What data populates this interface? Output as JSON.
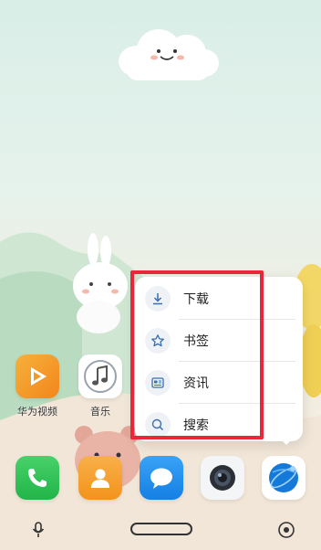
{
  "home": {
    "apps_row": [
      {
        "label": "华为视频",
        "icon": "huawei-video-icon"
      },
      {
        "label": "音乐",
        "icon": "music-icon"
      }
    ],
    "dock": [
      {
        "icon": "phone-icon"
      },
      {
        "icon": "contacts-icon"
      },
      {
        "icon": "messages-icon"
      },
      {
        "icon": "camera-icon"
      },
      {
        "icon": "browser-icon"
      }
    ]
  },
  "popup_menu": {
    "items": [
      {
        "label": "下载",
        "icon": "download-icon"
      },
      {
        "label": "书签",
        "icon": "star-icon"
      },
      {
        "label": "资讯",
        "icon": "news-icon"
      },
      {
        "label": "搜索",
        "icon": "search-icon"
      }
    ],
    "highlight_color": "#e8273a"
  },
  "nav": {
    "left_icon": "microphone-icon",
    "right_icon": "eye-icon"
  },
  "colors": {
    "video_orange": "#f59a23",
    "phone_green": "#2fc353",
    "contacts_orange": "#f7a233",
    "messages_blue": "#1f8ff0",
    "browser_blue": "#1479d9"
  }
}
